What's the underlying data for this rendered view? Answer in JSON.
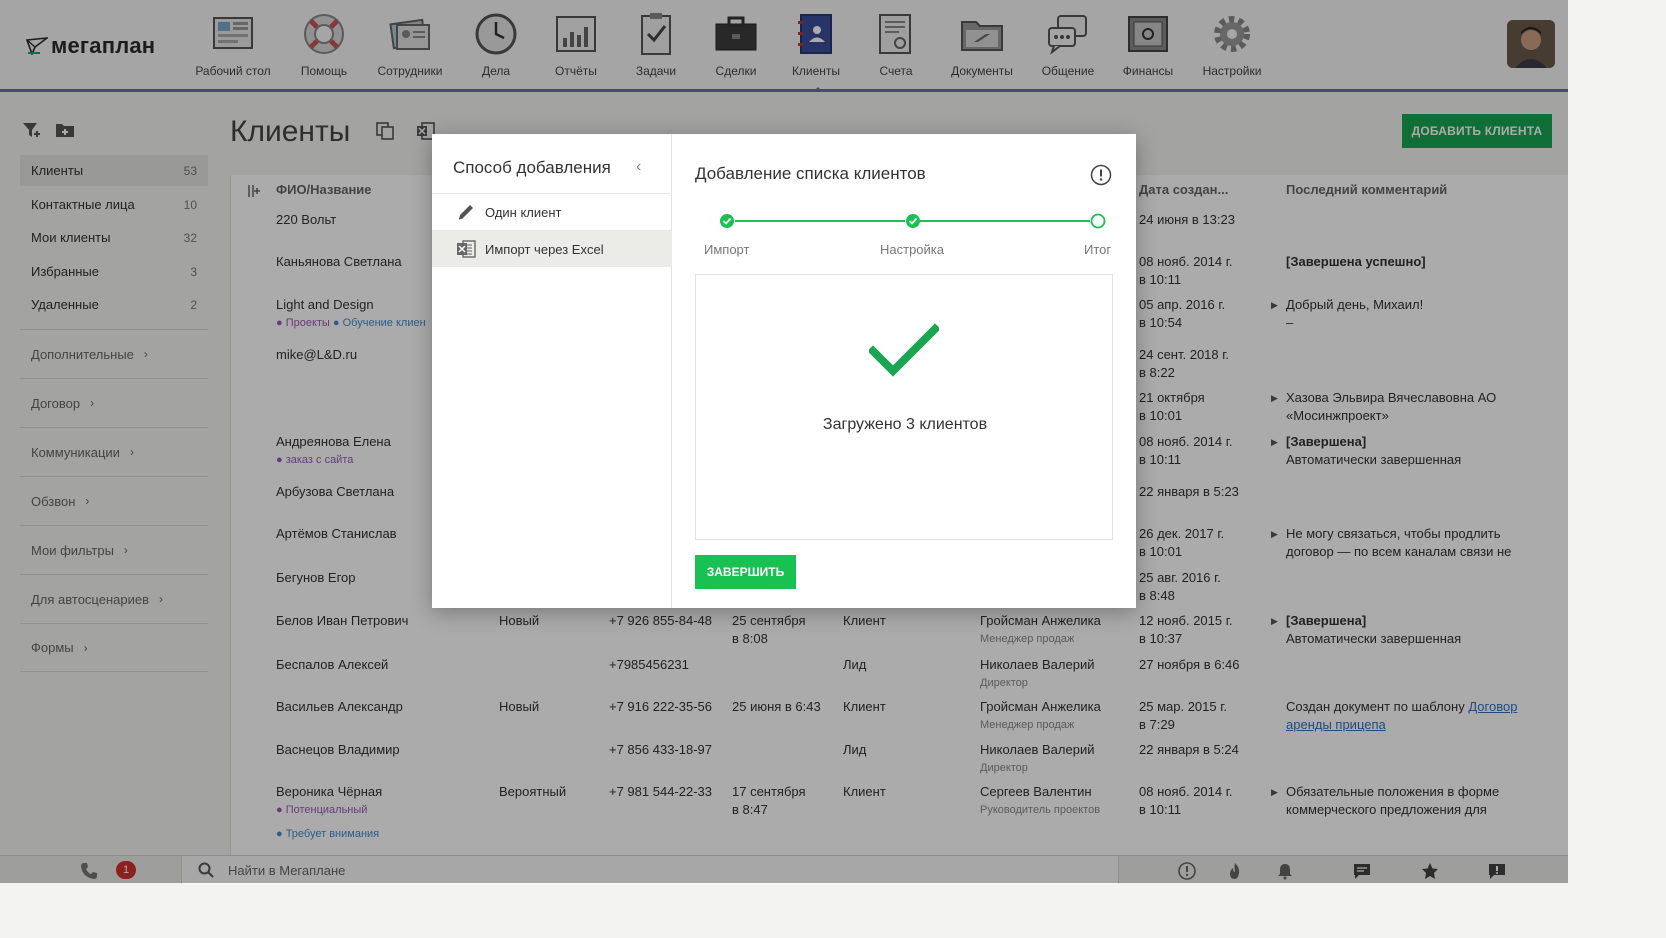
{
  "app": {
    "logo_text": "мегаплан"
  },
  "nav": [
    {
      "label": "Рабочий стол",
      "icon": "desktop-icon"
    },
    {
      "label": "Помощь",
      "icon": "lifebuoy-icon"
    },
    {
      "label": "Сотрудники",
      "icon": "employees-icon"
    },
    {
      "label": "Дела",
      "icon": "clock-icon"
    },
    {
      "label": "Отчёты",
      "icon": "chart-icon"
    },
    {
      "label": "Задачи",
      "icon": "clipboard-icon"
    },
    {
      "label": "Сделки",
      "icon": "briefcase-icon"
    },
    {
      "label": "Клиенты",
      "icon": "contacts-book-icon"
    },
    {
      "label": "Счета",
      "icon": "invoice-icon"
    },
    {
      "label": "Документы",
      "icon": "folder-icon"
    },
    {
      "label": "Общение",
      "icon": "chat-icon"
    },
    {
      "label": "Финансы",
      "icon": "safe-icon"
    },
    {
      "label": "Настройки",
      "icon": "gear-icon"
    }
  ],
  "sidebar": {
    "items": [
      {
        "label": "Клиенты",
        "count": "53"
      },
      {
        "label": "Контактные лица",
        "count": "10"
      },
      {
        "label": "Мои клиенты",
        "count": "32"
      },
      {
        "label": "Избранные",
        "count": "3"
      },
      {
        "label": "Удаленные",
        "count": "2"
      }
    ],
    "groups": [
      "Дополнительные",
      "Договор",
      "Коммуникации",
      "Обзвон",
      "Мои фильтры",
      "Для автосценариев",
      "Формы"
    ]
  },
  "page": {
    "title": "Клиенты",
    "add_button": "ДОБАВИТЬ КЛИЕНТА"
  },
  "table": {
    "headers": {
      "name": "ФИО/Название",
      "created": "Дата создан...",
      "comment": "Последний комментарий"
    },
    "rows": [
      {
        "name": "220 Вольт",
        "created": [
          "24 июня в 13:23"
        ],
        "comment": []
      },
      {
        "name": "Каньянова Светлана",
        "created": [
          "08 нояб. 2014 г.",
          "в 10:11"
        ],
        "comment": [
          "[Завершена успешно]"
        ]
      },
      {
        "name": "Light and Design",
        "tags": [
          "Проекты",
          "Обучение клиен"
        ],
        "created": [
          "05 апр. 2016 г.",
          "в 10:54"
        ],
        "comment": [
          "Добрый день, Михаил!",
          "–"
        ]
      },
      {
        "name": "mike@L&D.ru",
        "created": [
          "24 сент. 2018 г.",
          "в 8:22"
        ],
        "comment": []
      },
      {
        "name": "",
        "created": [
          "21 октября",
          "в 10:01"
        ],
        "comment": [
          "Хазова Эльвира Вячеславовна  АО",
          "«Мосинжпроект»"
        ]
      },
      {
        "name": "Андреянова Елена",
        "tags": [
          "заказ с сайта"
        ],
        "created": [
          "08 нояб. 2014 г.",
          "в 10:11"
        ],
        "comment": [
          "[Завершена]",
          "Автоматически завершенная"
        ]
      },
      {
        "name": "Арбузова Светлана",
        "created": [
          "22 января в 5:23"
        ],
        "comment": []
      },
      {
        "name": "Артёмов Станислав",
        "created": [
          "26 дек. 2017 г.",
          "в 10:01"
        ],
        "comment": [
          "Не могу связаться, чтобы продлить",
          "договор — по всем каналам связи не"
        ]
      },
      {
        "name": "Бегунов Егор",
        "created": [
          "25 авг. 2016 г.",
          "в 8:48"
        ],
        "comment": []
      },
      {
        "name": "Белов Иван Петрович",
        "status": "Новый",
        "phone": "+7 926 855-84-48",
        "date": [
          "25 сентября",
          "в 8:08"
        ],
        "type": "Клиент",
        "manager": "Гройсман Анжелика",
        "role": "Менеджер продаж",
        "created": [
          "12 нояб. 2015 г.",
          "в 10:37"
        ],
        "comment": [
          "[Завершена]",
          "Автоматически завершенная"
        ]
      },
      {
        "name": "Беспалов Алексей",
        "phone": "+7985456231",
        "type": "Лид",
        "manager": "Николаев Валерий",
        "role": "Директор",
        "created": [
          "27 ноября в 6:46"
        ],
        "comment": []
      },
      {
        "name": "Васильев Александр",
        "status": "Новый",
        "phone": "+7 916 222-35-56",
        "date": [
          "25 июня в 6:43"
        ],
        "type": "Клиент",
        "manager": "Гройсман Анжелика",
        "role": "Менеджер продаж",
        "created": [
          "25 мар. 2015 г.",
          "в 7:29"
        ],
        "comment": [
          "Создан документ по шаблону",
          "Договор",
          "аренды прицепа"
        ]
      },
      {
        "name": "Васнецов Владимир",
        "phone": "+7 856 433-18-97",
        "type": "Лид",
        "manager": "Николаев Валерий",
        "role": "Директор",
        "created": [
          "22 января в 5:24"
        ],
        "comment": []
      },
      {
        "name": "Вероника Чёрная",
        "tags": [
          "Потенциальный",
          "Требует внимания"
        ],
        "status": "Вероятный",
        "phone": "+7 981 544-22-33",
        "date": [
          "17 сентября",
          "в 8:47"
        ],
        "type": "Клиент",
        "manager": "Сергеев Валентин",
        "role": "Руководитель проектов",
        "created": [
          "08 нояб. 2014 г.",
          "в 10:11"
        ],
        "comment": [
          "Обязательные положения в форме",
          "коммерческого предложения для"
        ]
      }
    ]
  },
  "modal": {
    "left_title": "Способ добавления",
    "options": [
      "Один клиент",
      "Импорт через Excel"
    ],
    "right_title": "Добавление списка клиентов",
    "steps": [
      "Импорт",
      "Настройка",
      "Итог"
    ],
    "result": "Загружено 3 клиентов",
    "finish": "ЗАВЕРШИТЬ"
  },
  "bottombar": {
    "search_placeholder": "Найти в Мегаплане",
    "notifications_count": "1"
  },
  "colors": {
    "accent": "#6b6fb0",
    "success": "#19c152",
    "button": "#19a552"
  }
}
